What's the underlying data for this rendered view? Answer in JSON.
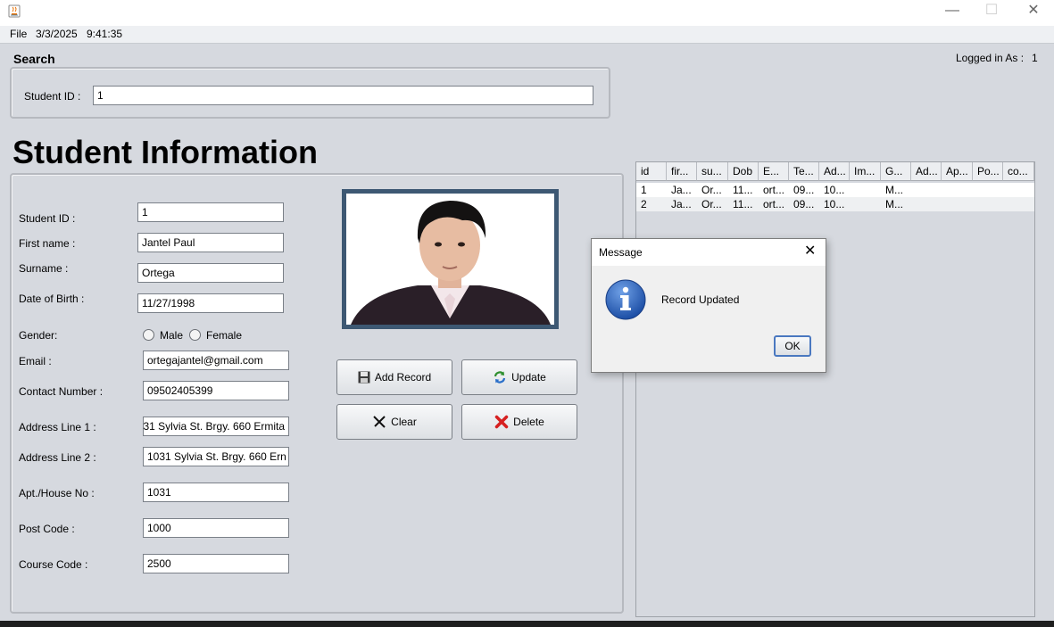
{
  "window": {
    "minimize_glyph": "—",
    "maximize_glyph": "☐",
    "close_glyph": "✕",
    "icon": "java-cup-icon"
  },
  "menu": {
    "file": "File",
    "date": "3/3/2025",
    "time": "9:41:35"
  },
  "logged_in": {
    "label": "Logged in As :",
    "user": "1"
  },
  "search": {
    "title": "Search",
    "student_id_label": "Student ID :",
    "student_id_value": "1"
  },
  "info": {
    "title": "Student Information",
    "fields": {
      "student_id": {
        "label": "Student ID :",
        "value": "1"
      },
      "first_name": {
        "label": "First name :",
        "value": "Jantel Paul"
      },
      "surname": {
        "label": "Surname :",
        "value": "Ortega"
      },
      "dob": {
        "label": "Date of Birth :",
        "value": "11/27/1998"
      },
      "gender": {
        "label": "Gender:",
        "male": "Male",
        "female": "Female"
      },
      "email": {
        "label": "Email :",
        "value": "ortegajantel@gmail.com"
      },
      "contact": {
        "label": "Contact Number :",
        "value": "09502405399"
      },
      "address1": {
        "label": "Address Line 1 :",
        "value": "31 Sylvia St. Brgy. 660 Ermita"
      },
      "address2": {
        "label": "Address Line 2 :",
        "value": "1031 Sylvia St. Brgy. 660 Ern"
      },
      "apt": {
        "label": "Apt./House No :",
        "value": "1031"
      },
      "post_code": {
        "label": "Post Code :",
        "value": "1000"
      },
      "course_code": {
        "label": "Course Code :",
        "value": "2500"
      }
    },
    "buttons": {
      "add": "Add Record",
      "update": "Update",
      "clear": "Clear",
      "delete": "Delete"
    }
  },
  "table": {
    "headers": [
      "id",
      "fir...",
      "su...",
      "Dob",
      "E...",
      "Te...",
      "Ad...",
      "Im...",
      "G...",
      "Ad...",
      "Ap...",
      "Po...",
      "co..."
    ],
    "rows": [
      [
        "1",
        "Ja...",
        "Or...",
        "11...",
        "ort...",
        "09...",
        "10...",
        "",
        "M...",
        "",
        "",
        "",
        ""
      ],
      [
        "2",
        "Ja...",
        "Or...",
        "11...",
        "ort...",
        "09...",
        "10...",
        "",
        "M...",
        "",
        "",
        "",
        ""
      ]
    ]
  },
  "dialog": {
    "title": "Message",
    "message": "Record Updated",
    "ok": "OK",
    "icon": "info-icon"
  }
}
